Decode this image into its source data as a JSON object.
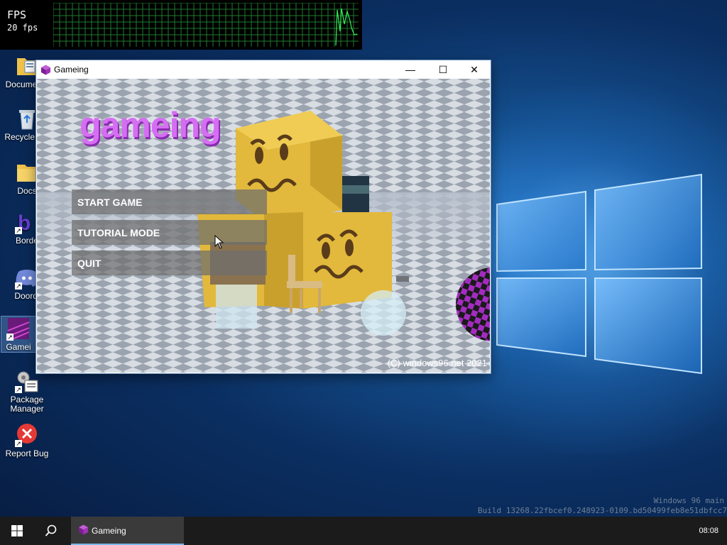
{
  "fps_widget": {
    "label": "FPS",
    "value": "20 fps"
  },
  "desktop_icons": [
    {
      "label": "Documents",
      "icon": "folder-document-icon"
    },
    {
      "label": "Recycle Bin",
      "icon": "recycle-bin-icon"
    },
    {
      "label": "Docs",
      "icon": "folder-icon"
    },
    {
      "label": "Borde",
      "icon": "app-shortcut-icon"
    },
    {
      "label": "Doordi",
      "icon": "discord-icon"
    },
    {
      "label": "Gamei",
      "icon": "game-icon"
    },
    {
      "label": "Package Manager",
      "icon": "package-manager-icon"
    },
    {
      "label": "Report Bug",
      "icon": "report-bug-icon"
    }
  ],
  "window": {
    "title": "Gameing",
    "controls": {
      "minimize": "—",
      "maximize": "☐",
      "close": "✕"
    }
  },
  "game": {
    "title": "gameing",
    "menu": [
      "START GAME",
      "TUTORIAL MODE",
      "QUIT"
    ],
    "copyright": "(C) windows96.net 2021"
  },
  "build_info": {
    "line1": "Windows 96 main",
    "line2": "Build 13268.22fbcef0.248923-0109.bd50499feb8e51dbfcc7"
  },
  "taskbar": {
    "task_label": "Gameing",
    "clock": "08:08"
  },
  "colors": {
    "accent": "#79b8ec",
    "game_title": "#d56ef2",
    "fps_graph": "#2ad64a"
  }
}
